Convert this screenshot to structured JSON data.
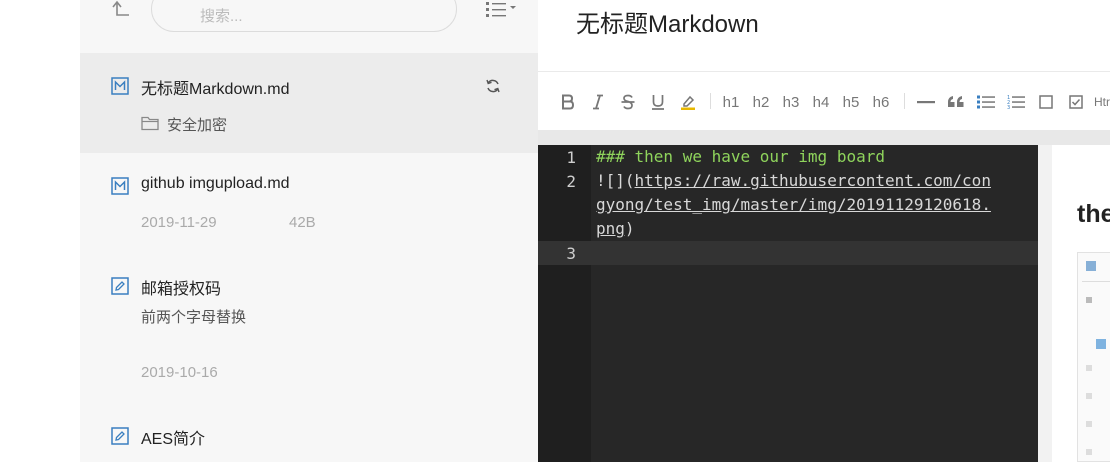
{
  "search": {
    "placeholder": "搜索..."
  },
  "notes": [
    {
      "title": "无标题Markdown.md",
      "folder": "安全加密",
      "icon": "markdown-file-icon",
      "selected": true,
      "status_icon": "sync-icon"
    },
    {
      "title": "github imgupload.md",
      "date": "2019-11-29",
      "size": "42B",
      "icon": "markdown-file-icon"
    },
    {
      "title": "邮箱授权码",
      "snippet": "前两个字母替换",
      "date": "2019-10-16",
      "icon": "note-edit-icon"
    },
    {
      "title": "AES简介",
      "icon": "note-edit-icon"
    }
  ],
  "document": {
    "title": "无标题Markdown"
  },
  "toolbar": {
    "headings": [
      "h1",
      "h2",
      "h3",
      "h4",
      "h5",
      "h6"
    ],
    "icons": [
      "bold-icon",
      "italic-icon",
      "strikethrough-icon",
      "underline-icon",
      "highlight-icon",
      "horizontal-rule-icon",
      "quote-icon",
      "bullet-list-icon",
      "numbered-list-icon",
      "checkbox-icon",
      "checked-box-icon"
    ],
    "partial_label": "Htr"
  },
  "editor": {
    "line_numbers": [
      "1",
      "2",
      "3"
    ],
    "line1": "### then we have our img board",
    "line2_prefix": "![](",
    "line2_url_a": "https://raw.githubusercontent.com/con",
    "line2_url_b": "gyong/test_img/master/img/20191129120618.",
    "line2_url_c": "png",
    "line2_suffix": ")"
  },
  "preview": {
    "heading": "then we have our img board"
  },
  "colors": {
    "accent": "#3a7fc0",
    "editor_bg": "#272727",
    "heading_green": "#8fd45c",
    "highlight_yellow": "#e8b800"
  }
}
